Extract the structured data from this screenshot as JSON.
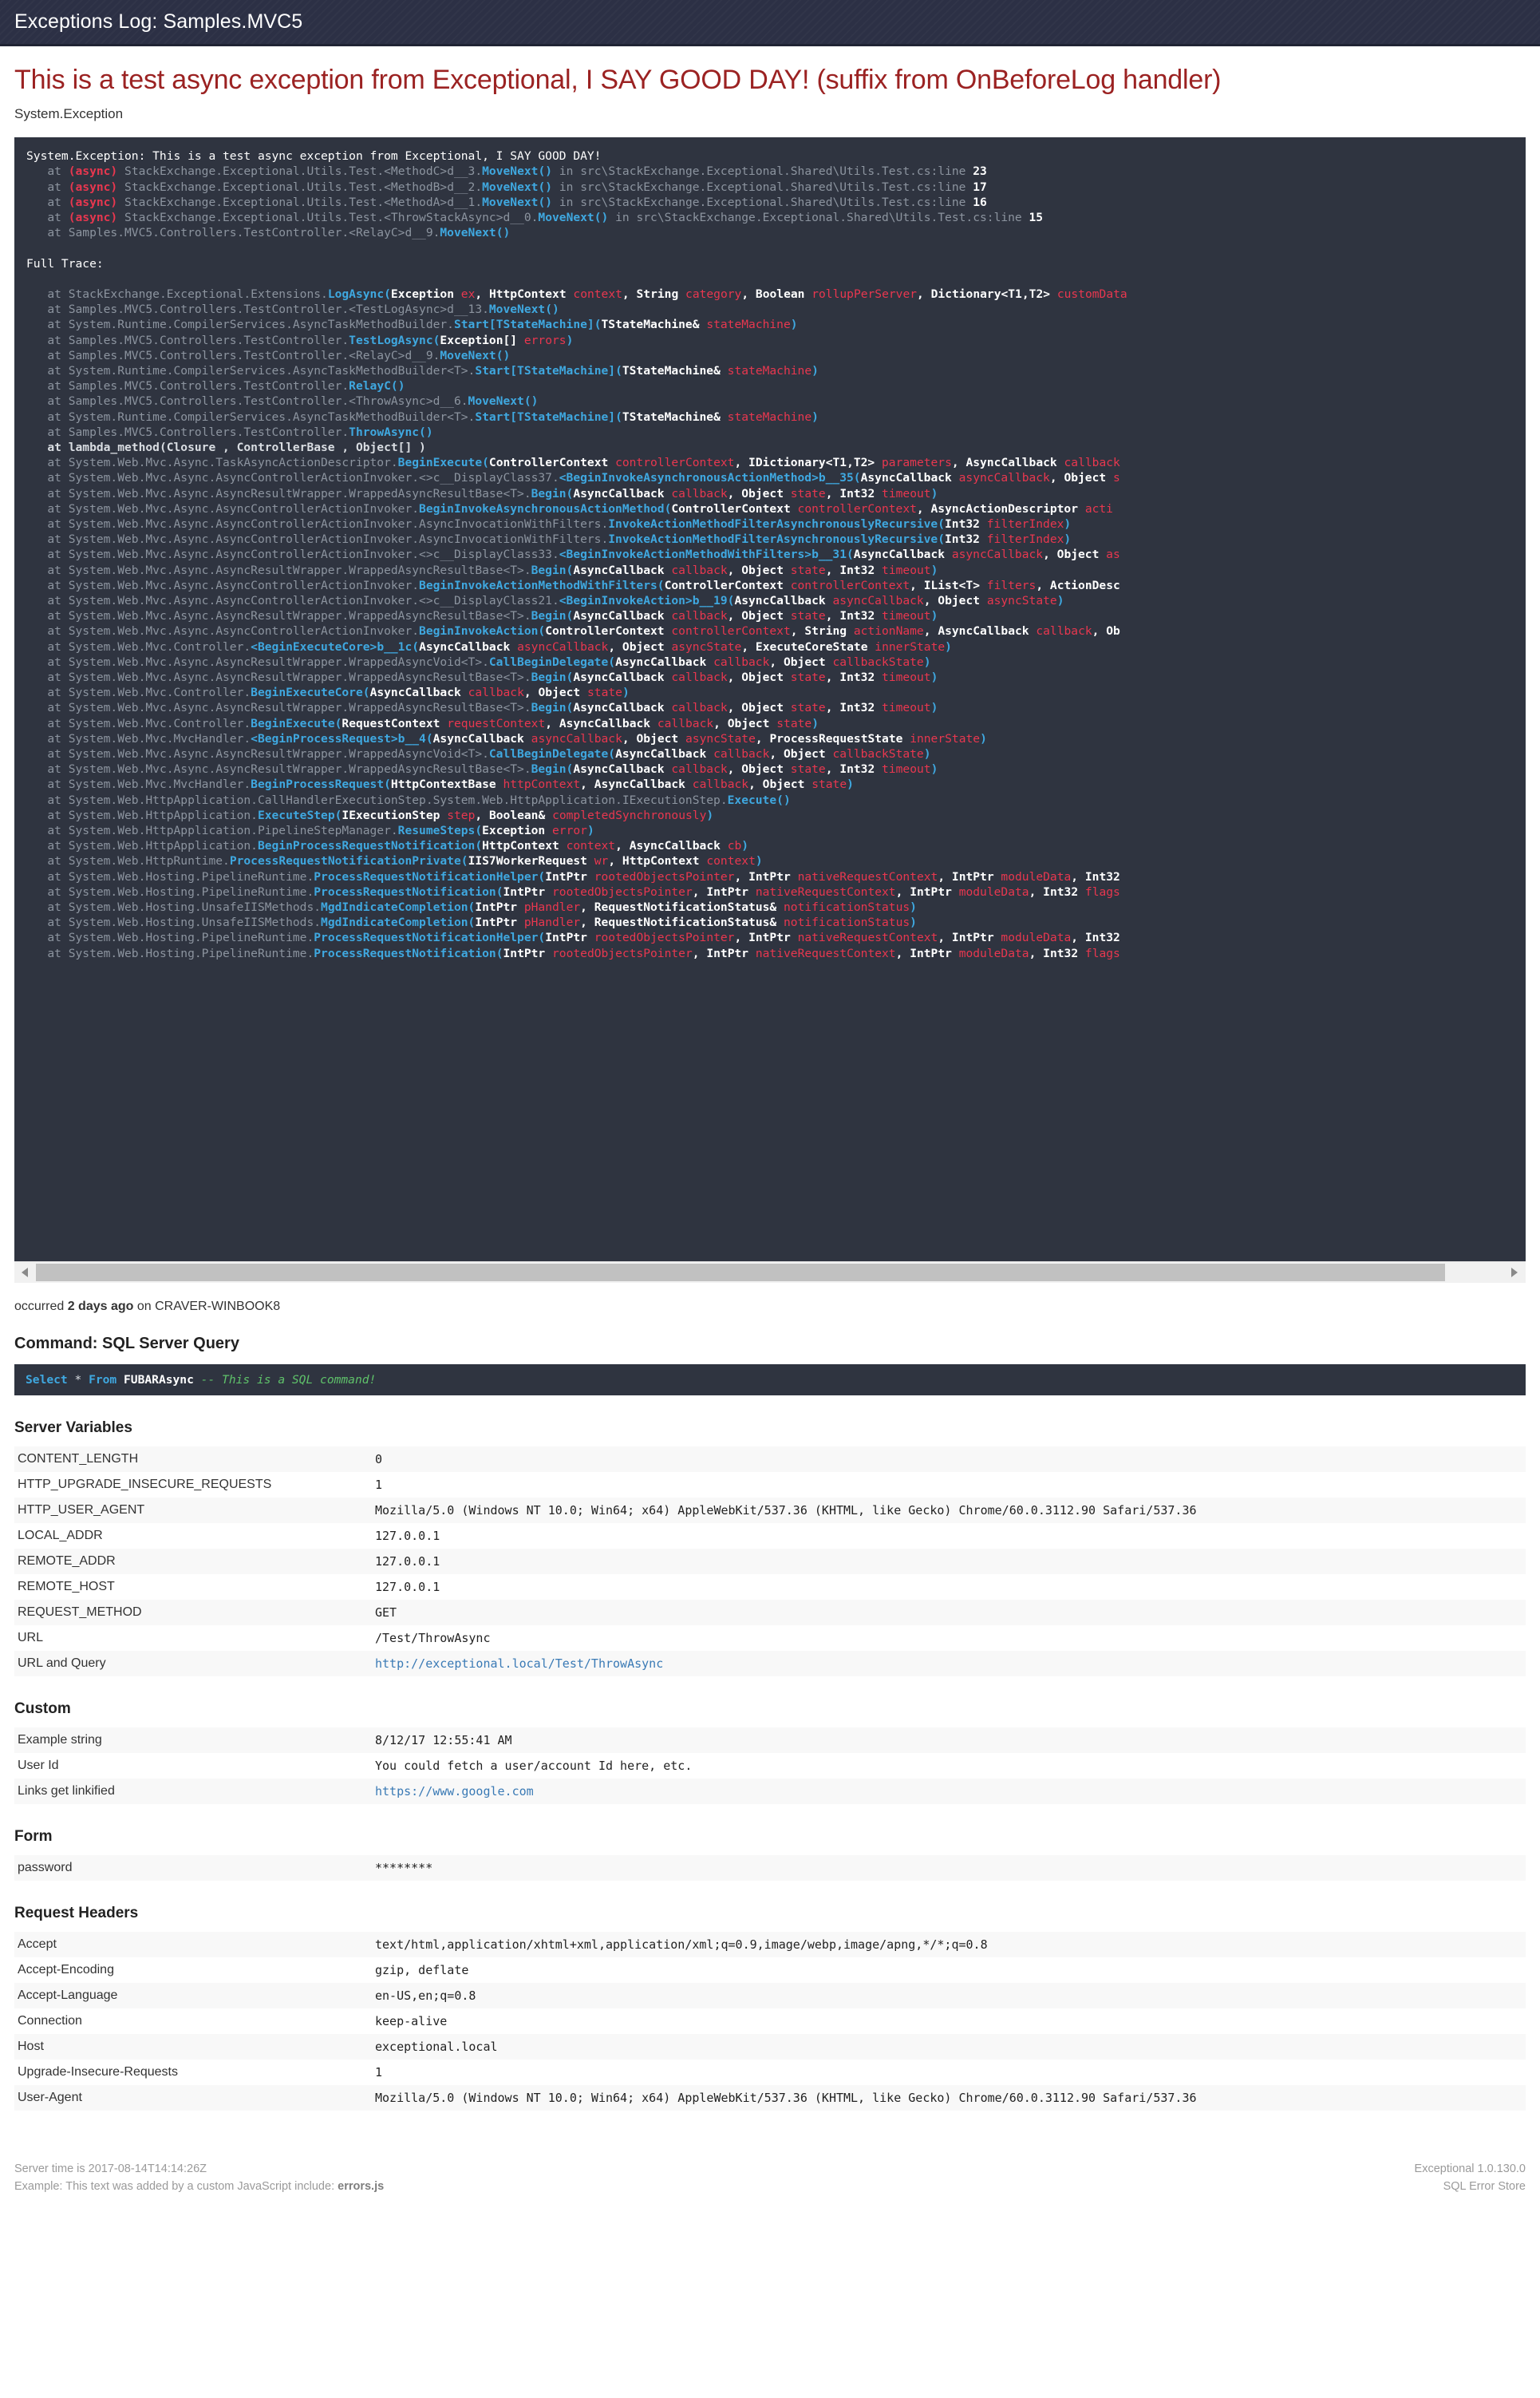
{
  "header": {
    "title": "Exceptions Log: Samples.MVC5"
  },
  "error": {
    "title": "This is a test async exception from Exceptional, I SAY GOOD DAY! (suffix from OnBeforeLog handler)",
    "type": "System.Exception",
    "occurred_prefix": "occurred ",
    "occurred_relative": "2 days ago",
    "occurred_suffix": " on CRAVER-WINBOOK8"
  },
  "stack_trace": {
    "message": "System.Exception: This is a test async exception from Exceptional, I SAY GOOD DAY!",
    "full_trace_label": "Full Trace:",
    "short_frames": [
      "   at (async) StackExchange.Exceptional.Utils.Test.<MethodC>d__3.MoveNext() in src\\StackExchange.Exceptional.Shared\\Utils.Test.cs:line 23",
      "   at (async) StackExchange.Exceptional.Utils.Test.<MethodB>d__2.MoveNext() in src\\StackExchange.Exceptional.Shared\\Utils.Test.cs:line 17",
      "   at (async) StackExchange.Exceptional.Utils.Test.<MethodA>d__1.MoveNext() in src\\StackExchange.Exceptional.Shared\\Utils.Test.cs:line 16",
      "   at (async) StackExchange.Exceptional.Utils.Test.<ThrowStackAsync>d__0.MoveNext() in src\\StackExchange.Exceptional.Shared\\Utils.Test.cs:line 15",
      "   at Samples.MVC5.Controllers.TestController.<RelayC>d__9.MoveNext()"
    ],
    "full_frames": [
      "   at StackExchange.Exceptional.Extensions.LogAsync(Exception ex, HttpContext context, String category, Boolean rollupPerServer, Dictionary<T1,T2> customData",
      "   at Samples.MVC5.Controllers.TestController.<TestLogAsync>d__13.MoveNext()",
      "   at System.Runtime.CompilerServices.AsyncTaskMethodBuilder.Start[TStateMachine](TStateMachine& stateMachine)",
      "   at Samples.MVC5.Controllers.TestController.TestLogAsync(Exception[] errors)",
      "   at Samples.MVC5.Controllers.TestController.<RelayC>d__9.MoveNext()",
      "   at System.Runtime.CompilerServices.AsyncTaskMethodBuilder<T>.Start[TStateMachine](TStateMachine& stateMachine)",
      "   at Samples.MVC5.Controllers.TestController.RelayC()",
      "   at Samples.MVC5.Controllers.TestController.<ThrowAsync>d__6.MoveNext()",
      "   at System.Runtime.CompilerServices.AsyncTaskMethodBuilder<T>.Start[TStateMachine](TStateMachine& stateMachine)",
      "   at Samples.MVC5.Controllers.TestController.ThrowAsync()",
      "   at lambda_method(Closure , ControllerBase , Object[] )",
      "   at System.Web.Mvc.Async.TaskAsyncActionDescriptor.BeginExecute(ControllerContext controllerContext, IDictionary<T1,T2> parameters, AsyncCallback callback",
      "   at System.Web.Mvc.Async.AsyncControllerActionInvoker.<>c__DisplayClass37.<BeginInvokeAsynchronousActionMethod>b__35(AsyncCallback asyncCallback, Object s",
      "   at System.Web.Mvc.Async.AsyncResultWrapper.WrappedAsyncResultBase<T>.Begin(AsyncCallback callback, Object state, Int32 timeout)",
      "   at System.Web.Mvc.Async.AsyncControllerActionInvoker.BeginInvokeAsynchronousActionMethod(ControllerContext controllerContext, AsyncActionDescriptor acti",
      "   at System.Web.Mvc.Async.AsyncControllerActionInvoker.AsyncInvocationWithFilters.InvokeActionMethodFilterAsynchronouslyRecursive(Int32 filterIndex)",
      "   at System.Web.Mvc.Async.AsyncControllerActionInvoker.AsyncInvocationWithFilters.InvokeActionMethodFilterAsynchronouslyRecursive(Int32 filterIndex)",
      "   at System.Web.Mvc.Async.AsyncControllerActionInvoker.<>c__DisplayClass33.<BeginInvokeActionMethodWithFilters>b__31(AsyncCallback asyncCallback, Object as",
      "   at System.Web.Mvc.Async.AsyncResultWrapper.WrappedAsyncResultBase<T>.Begin(AsyncCallback callback, Object state, Int32 timeout)",
      "   at System.Web.Mvc.Async.AsyncControllerActionInvoker.BeginInvokeActionMethodWithFilters(ControllerContext controllerContext, IList<T> filters, ActionDesc",
      "   at System.Web.Mvc.Async.AsyncControllerActionInvoker.<>c__DisplayClass21.<BeginInvokeAction>b__19(AsyncCallback asyncCallback, Object asyncState)",
      "   at System.Web.Mvc.Async.AsyncResultWrapper.WrappedAsyncResultBase<T>.Begin(AsyncCallback callback, Object state, Int32 timeout)",
      "   at System.Web.Mvc.Async.AsyncControllerActionInvoker.BeginInvokeAction(ControllerContext controllerContext, String actionName, AsyncCallback callback, Ob",
      "   at System.Web.Mvc.Controller.<BeginExecuteCore>b__1c(AsyncCallback asyncCallback, Object asyncState, ExecuteCoreState innerState)",
      "   at System.Web.Mvc.Async.AsyncResultWrapper.WrappedAsyncVoid<T>.CallBeginDelegate(AsyncCallback callback, Object callbackState)",
      "   at System.Web.Mvc.Async.AsyncResultWrapper.WrappedAsyncResultBase<T>.Begin(AsyncCallback callback, Object state, Int32 timeout)",
      "   at System.Web.Mvc.Controller.BeginExecuteCore(AsyncCallback callback, Object state)",
      "   at System.Web.Mvc.Async.AsyncResultWrapper.WrappedAsyncResultBase<T>.Begin(AsyncCallback callback, Object state, Int32 timeout)",
      "   at System.Web.Mvc.Controller.BeginExecute(RequestContext requestContext, AsyncCallback callback, Object state)",
      "   at System.Web.Mvc.MvcHandler.<BeginProcessRequest>b__4(AsyncCallback asyncCallback, Object asyncState, ProcessRequestState innerState)",
      "   at System.Web.Mvc.Async.AsyncResultWrapper.WrappedAsyncVoid<T>.CallBeginDelegate(AsyncCallback callback, Object callbackState)",
      "   at System.Web.Mvc.Async.AsyncResultWrapper.WrappedAsyncResultBase<T>.Begin(AsyncCallback callback, Object state, Int32 timeout)",
      "   at System.Web.Mvc.MvcHandler.BeginProcessRequest(HttpContextBase httpContext, AsyncCallback callback, Object state)",
      "   at System.Web.HttpApplication.CallHandlerExecutionStep.System.Web.HttpApplication.IExecutionStep.Execute()",
      "   at System.Web.HttpApplication.ExecuteStep(IExecutionStep step, Boolean& completedSynchronously)",
      "   at System.Web.HttpApplication.PipelineStepManager.ResumeSteps(Exception error)",
      "   at System.Web.HttpApplication.BeginProcessRequestNotification(HttpContext context, AsyncCallback cb)",
      "   at System.Web.HttpRuntime.ProcessRequestNotificationPrivate(IIS7WorkerRequest wr, HttpContext context)",
      "   at System.Web.Hosting.PipelineRuntime.ProcessRequestNotificationHelper(IntPtr rootedObjectsPointer, IntPtr nativeRequestContext, IntPtr moduleData, Int32",
      "   at System.Web.Hosting.PipelineRuntime.ProcessRequestNotification(IntPtr rootedObjectsPointer, IntPtr nativeRequestContext, IntPtr moduleData, Int32 flags",
      "   at System.Web.Hosting.UnsafeIISMethods.MgdIndicateCompletion(IntPtr pHandler, RequestNotificationStatus& notificationStatus)",
      "   at System.Web.Hosting.UnsafeIISMethods.MgdIndicateCompletion(IntPtr pHandler, RequestNotificationStatus& notificationStatus)",
      "   at System.Web.Hosting.PipelineRuntime.ProcessRequestNotificationHelper(IntPtr rootedObjectsPointer, IntPtr nativeRequestContext, IntPtr moduleData, Int32",
      "   at System.Web.Hosting.PipelineRuntime.ProcessRequestNotification(IntPtr rootedObjectsPointer, IntPtr nativeRequestContext, IntPtr moduleData, Int32 flags"
    ]
  },
  "command": {
    "heading": "Command: SQL Server Query",
    "sql_keyword1": "Select",
    "sql_star": " * ",
    "sql_keyword2": "From",
    "sql_table": " FUBARAsync ",
    "sql_comment": "-- This is a SQL command!"
  },
  "sections": {
    "server_variables": {
      "heading": "Server Variables",
      "rows": [
        {
          "key": "CONTENT_LENGTH",
          "value": "0"
        },
        {
          "key": "HTTP_UPGRADE_INSECURE_REQUESTS",
          "value": "1"
        },
        {
          "key": "HTTP_USER_AGENT",
          "value": "Mozilla/5.0 (Windows NT 10.0; Win64; x64) AppleWebKit/537.36 (KHTML, like Gecko) Chrome/60.0.3112.90 Safari/537.36"
        },
        {
          "key": "LOCAL_ADDR",
          "value": "127.0.0.1"
        },
        {
          "key": "REMOTE_ADDR",
          "value": "127.0.0.1"
        },
        {
          "key": "REMOTE_HOST",
          "value": "127.0.0.1"
        },
        {
          "key": "REQUEST_METHOD",
          "value": "GET"
        },
        {
          "key": "URL",
          "value": "/Test/ThrowAsync"
        },
        {
          "key": "URL and Query",
          "value": "http://exceptional.local/Test/ThrowAsync",
          "link": true
        }
      ]
    },
    "custom": {
      "heading": "Custom",
      "rows": [
        {
          "key": "Example string",
          "value": "8/12/17 12:55:41 AM"
        },
        {
          "key": "User Id",
          "value": "You could fetch a user/account Id here, etc."
        },
        {
          "key": "Links get linkified",
          "value": "https://www.google.com",
          "link": true
        }
      ]
    },
    "form": {
      "heading": "Form",
      "rows": [
        {
          "key": "password",
          "value": "********"
        }
      ]
    },
    "request_headers": {
      "heading": "Request Headers",
      "rows": [
        {
          "key": "Accept",
          "value": "text/html,application/xhtml+xml,application/xml;q=0.9,image/webp,image/apng,*/*;q=0.8"
        },
        {
          "key": "Accept-Encoding",
          "value": "gzip, deflate"
        },
        {
          "key": "Accept-Language",
          "value": "en-US,en;q=0.8"
        },
        {
          "key": "Connection",
          "value": "keep-alive"
        },
        {
          "key": "Host",
          "value": "exceptional.local"
        },
        {
          "key": "Upgrade-Insecure-Requests",
          "value": "1"
        },
        {
          "key": "User-Agent",
          "value": "Mozilla/5.0 (Windows NT 10.0; Win64; x64) AppleWebKit/537.36 (KHTML, like Gecko) Chrome/60.0.3112.90 Safari/537.36"
        }
      ]
    }
  },
  "footer": {
    "server_time": "Server time is 2017-08-14T14:14:26Z",
    "example_prefix": "Example: This text was added by a custom JavaScript include: ",
    "example_file": "errors.js",
    "version": "Exceptional 1.0.130.0",
    "store": "SQL Error Store"
  }
}
